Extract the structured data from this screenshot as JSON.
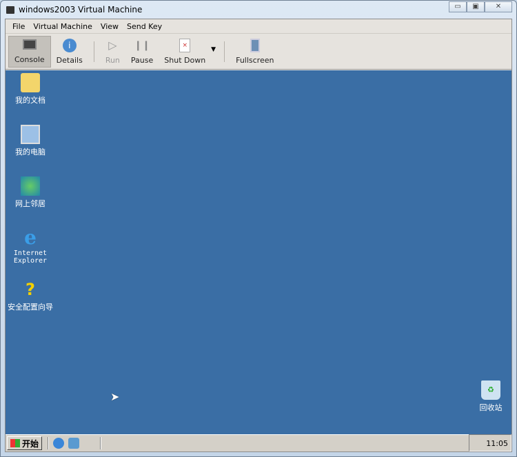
{
  "window": {
    "title": "windows2003 Virtual Machine",
    "minimize": "▭",
    "maximize": "▣",
    "close": "✕"
  },
  "menu": [
    "File",
    "Virtual Machine",
    "View",
    "Send Key"
  ],
  "toolbar": {
    "console": "Console",
    "details": "Details",
    "run": "Run",
    "pause": "Pause",
    "shutdown": "Shut Down",
    "fullscreen": "Fullscreen"
  },
  "desktop": {
    "icons": [
      "我的文档",
      "我的电脑",
      "网上邻居",
      "Internet Explorer",
      "安全配置向导"
    ],
    "recycle": "回收站",
    "bg": "#3a6ea5"
  },
  "taskbar": {
    "start": "开始",
    "clock": "11:05"
  }
}
